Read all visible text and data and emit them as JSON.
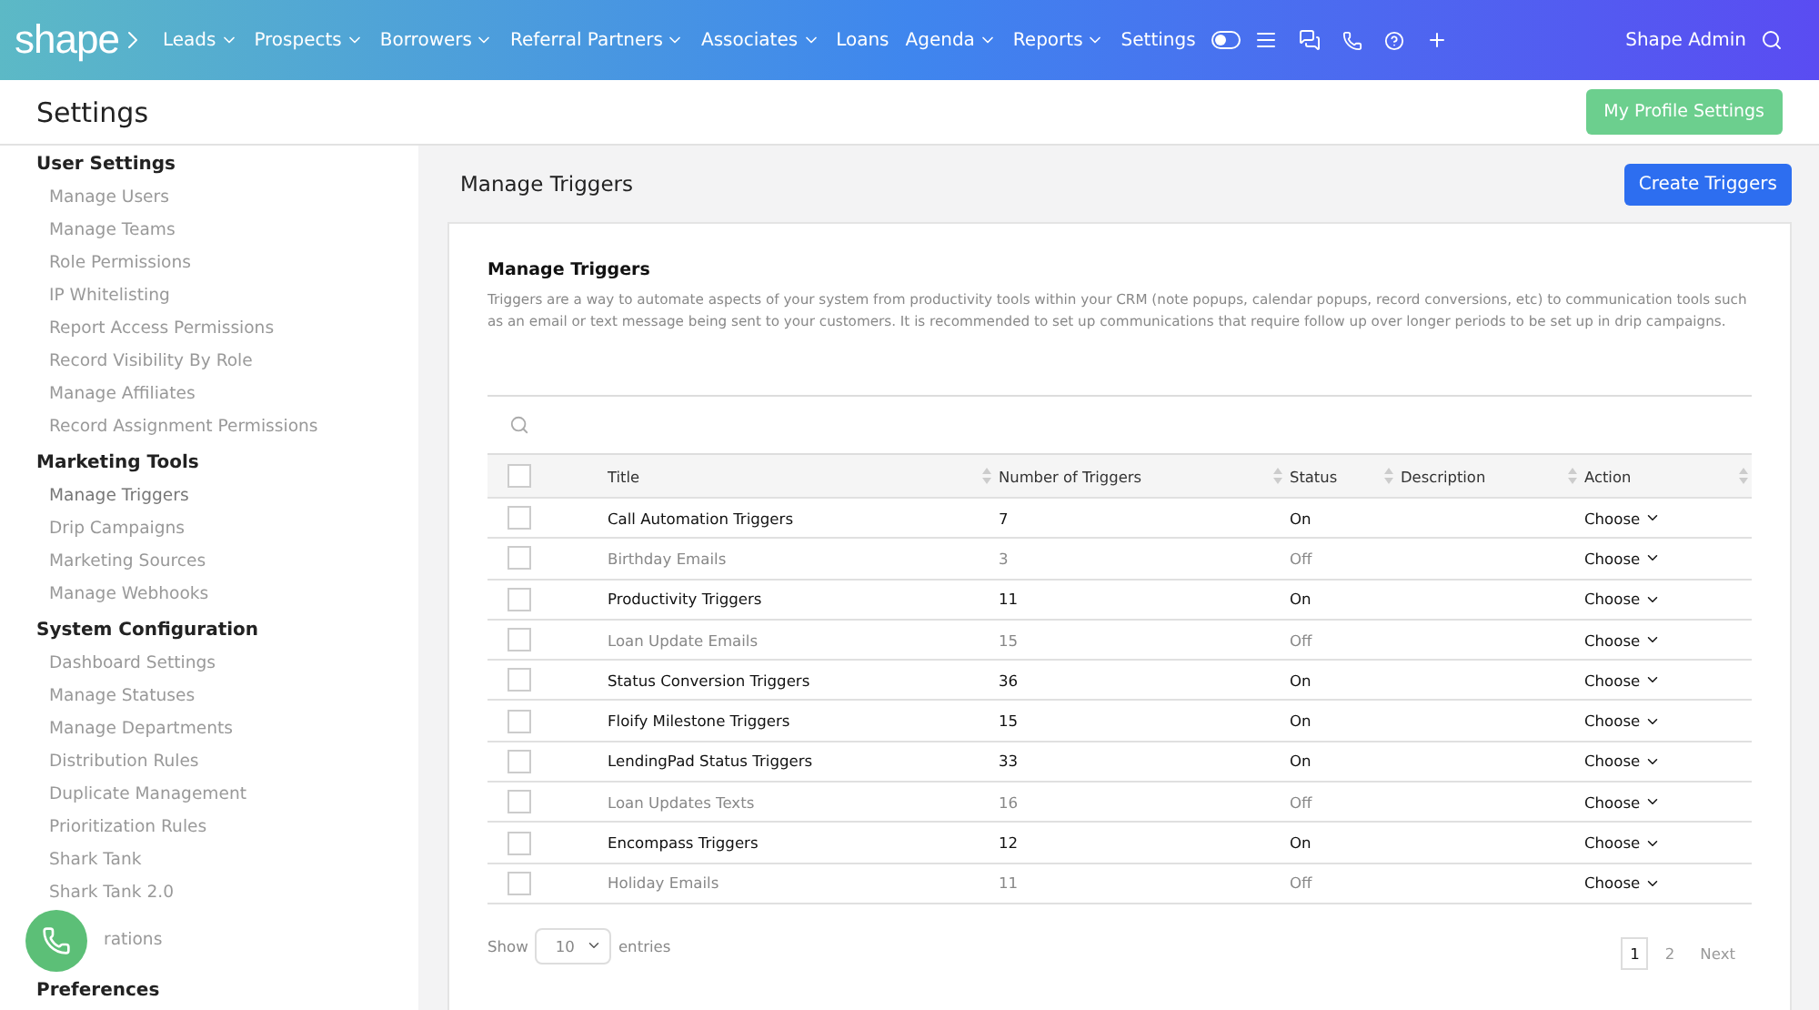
{
  "nav": {
    "logo": "shape",
    "menu": [
      {
        "label": "Leads",
        "dropdown": true
      },
      {
        "label": "Prospects",
        "dropdown": true
      },
      {
        "label": "Borrowers",
        "dropdown": true
      },
      {
        "label": "Referral Partners",
        "dropdown": true
      },
      {
        "label": "Associates",
        "dropdown": true
      },
      {
        "label": "Loans",
        "dropdown": false
      },
      {
        "label": "Agenda",
        "dropdown": true
      },
      {
        "label": "Reports",
        "dropdown": true
      },
      {
        "label": "Settings",
        "dropdown": false
      }
    ],
    "toggle_on": false,
    "user": "Shape Admin"
  },
  "header": {
    "title": "Settings",
    "button": "My Profile Settings"
  },
  "sidebar": {
    "sections": [
      {
        "heading": "User Settings",
        "items": [
          {
            "label": "Manage Users",
            "selected": false
          },
          {
            "label": "Manage Teams",
            "selected": false
          },
          {
            "label": "Role Permissions",
            "selected": false
          },
          {
            "label": "IP Whitelisting",
            "selected": false
          },
          {
            "label": "Report Access Permissions",
            "selected": false
          },
          {
            "label": "Record Visibility By Role",
            "selected": false
          },
          {
            "label": "Manage Affiliates",
            "selected": false
          },
          {
            "label": "Record Assignment Permissions",
            "selected": false
          }
        ]
      },
      {
        "heading": "Marketing Tools",
        "items": [
          {
            "label": "Manage Triggers",
            "selected": true
          },
          {
            "label": "Drip Campaigns",
            "selected": false
          },
          {
            "label": "Marketing Sources",
            "selected": false
          },
          {
            "label": "Manage Webhooks",
            "selected": false
          }
        ]
      },
      {
        "heading": "System Configuration",
        "items": [
          {
            "label": "Dashboard Settings",
            "selected": false
          },
          {
            "label": "Manage Statuses",
            "selected": false
          },
          {
            "label": "Manage Departments",
            "selected": false
          },
          {
            "label": "Distribution Rules",
            "selected": false
          },
          {
            "label": "Duplicate Management",
            "selected": false
          },
          {
            "label": "Prioritization Rules",
            "selected": false
          },
          {
            "label": "Shark Tank",
            "selected": false
          },
          {
            "label": "Shark Tank 2.0",
            "selected": false
          },
          {
            "label": "rations",
            "selected": false,
            "partly_hidden": true
          }
        ]
      },
      {
        "heading": "Preferences"
      }
    ]
  },
  "main": {
    "title": "Manage Triggers",
    "button": "Create Triggers"
  },
  "card": {
    "title": "Manage Triggers",
    "description": "Triggers are a way to automate aspects of your system from productivity tools within your CRM (note popups, calendar popups, record conversions, etc) to communication tools such as an email or text message being sent to your customers. It is recommended to set up communications that require follow up over longer periods to be set up in drip campaigns."
  },
  "table": {
    "select_all_checked": false,
    "columns": [
      "Title",
      "Number of Triggers",
      "Status",
      "Description",
      "Action"
    ],
    "rows": [
      {
        "title": "Call Automation Triggers",
        "count": "7",
        "status": "On",
        "enabled": true,
        "checked": false,
        "action": "Choose"
      },
      {
        "title": "Birthday Emails",
        "count": "3",
        "status": "Off",
        "enabled": false,
        "checked": false,
        "action": "Choose"
      },
      {
        "title": "Productivity Triggers",
        "count": "11",
        "status": "On",
        "enabled": true,
        "checked": false,
        "action": "Choose"
      },
      {
        "title": "Loan Update Emails",
        "count": "15",
        "status": "Off",
        "enabled": false,
        "checked": false,
        "action": "Choose"
      },
      {
        "title": "Status Conversion Triggers",
        "count": "36",
        "status": "On",
        "enabled": true,
        "checked": false,
        "action": "Choose"
      },
      {
        "title": "Floify Milestone Triggers",
        "count": "15",
        "status": "On",
        "enabled": true,
        "checked": false,
        "action": "Choose"
      },
      {
        "title": "LendingPad Status Triggers",
        "count": "33",
        "status": "On",
        "enabled": true,
        "checked": false,
        "action": "Choose"
      },
      {
        "title": "Loan Updates Texts",
        "count": "16",
        "status": "Off",
        "enabled": false,
        "checked": false,
        "action": "Choose"
      },
      {
        "title": "Encompass Triggers",
        "count": "12",
        "status": "On",
        "enabled": true,
        "checked": false,
        "action": "Choose"
      },
      {
        "title": "Holiday Emails",
        "count": "11",
        "status": "Off",
        "enabled": false,
        "checked": false,
        "action": "Choose"
      }
    ]
  },
  "footer": {
    "show": "Show",
    "page_size": "10",
    "entries": "entries",
    "pages": [
      {
        "label": "1",
        "selected": true
      },
      {
        "label": "2",
        "selected": false
      }
    ],
    "next": "Next"
  }
}
